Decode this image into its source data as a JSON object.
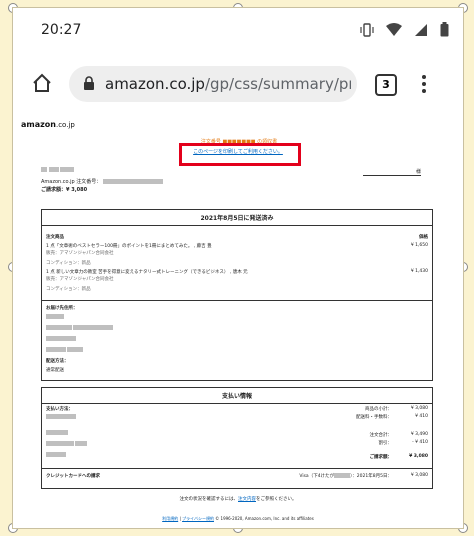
{
  "status_bar": {
    "time": "20:27"
  },
  "browser": {
    "url_host": "amazon.co.jp",
    "url_path": "/gp/css/summary/print.h",
    "tab_count": "3"
  },
  "page": {
    "logo_main": "amazon",
    "logo_suffix": ".co.jp",
    "notice_text": "注文番号 ■■■■■■■ の領収書",
    "print_link": "このページを印刷してご利用ください。",
    "recipient_suffix": "様",
    "order_label": "Amazon.co.jp 注文番号：",
    "total_label": "ご請求額：",
    "total_value": "¥ 3,080",
    "shipment": {
      "header": "2021年8月5日に発送済み",
      "items_label": "注文商品",
      "price_label": "価格",
      "items": [
        {
          "title": "1 点「文章術のベストセラー100冊」のポイントを1冊にまとめてみた。",
          "author": "藤吉 豊",
          "seller": "販売：アマゾンジャパン合同会社",
          "condition": "コンディション：新品",
          "price": "¥ 1,650"
        },
        {
          "title": "1 点 新しい文章力の教室 苦手を得意に変えるナタリー式トレーニング（できるビジネス）",
          "author": "唐木 元",
          "seller": "販売：アマゾンジャパン合同会社",
          "condition": "コンディション：新品",
          "price": "¥ 1,430"
        }
      ],
      "address_label": "お届け先住所：",
      "method_label": "配送方法：",
      "method_value": "通常配送"
    },
    "payment": {
      "header": "支払い情報",
      "method_label": "支払い方法：",
      "lines": [
        {
          "label": "商品の小計：",
          "value": "¥ 3,080"
        },
        {
          "label": "配送料・手数料：",
          "value": "¥ 410"
        },
        {
          "label": "注文合計：",
          "value": "¥ 3,490"
        },
        {
          "label": "割引：",
          "value": "- ¥ 410"
        }
      ],
      "total_label": "ご請求額：",
      "total_value": "¥ 3,080",
      "card_label": "クレジットカードへの請求",
      "card_detail": "Visa（下4けたが",
      "card_date": "）：2021年8月5日：",
      "card_value": "¥ 3,080"
    },
    "footer": {
      "status_prefix": "注文の状況を確認するには、",
      "status_link": "注文内容",
      "status_suffix": "をご参照ください。",
      "terms": "利用規約",
      "privacy": "プライバシー規約",
      "copyright": "© 1996-2020, Amazon.com, Inc. and its affiliates"
    }
  }
}
